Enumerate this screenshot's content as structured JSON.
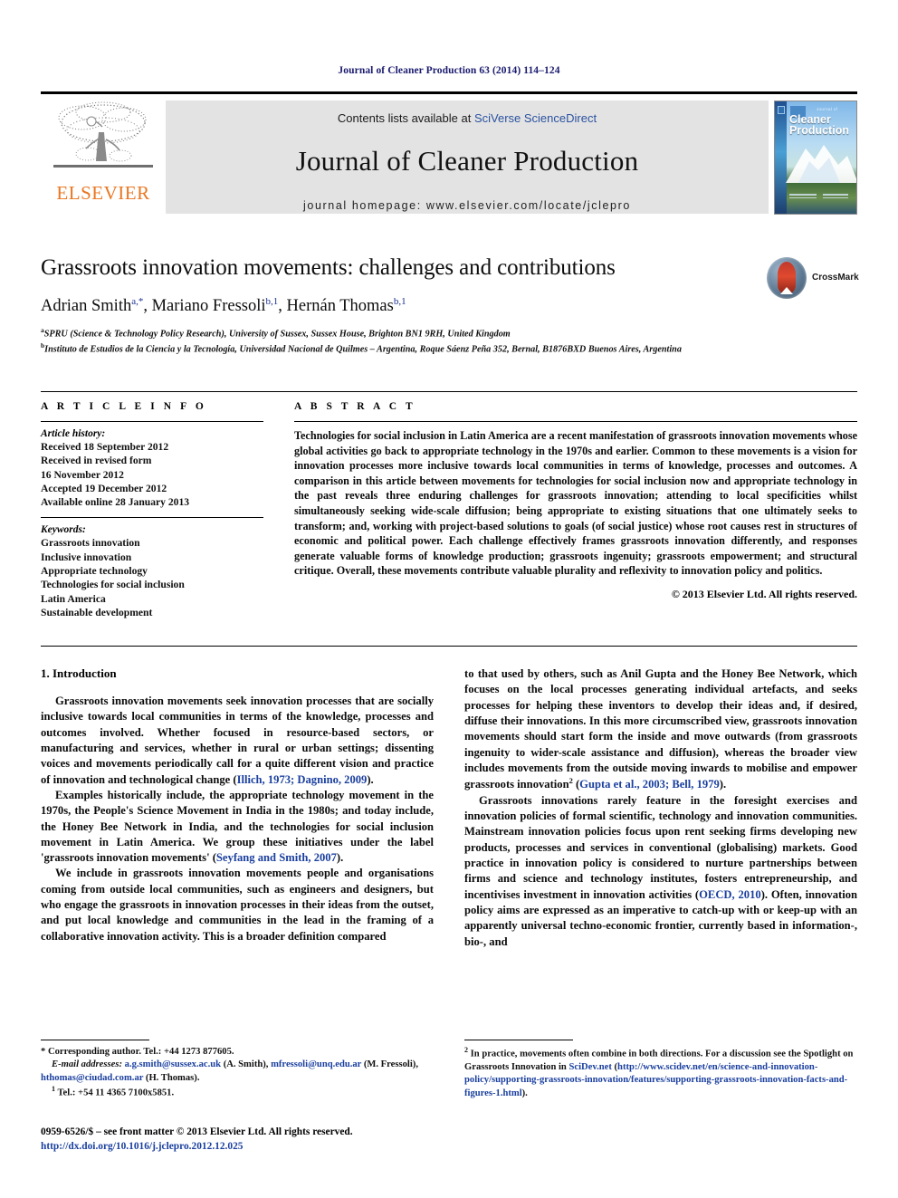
{
  "running_head": "Journal of Cleaner Production 63 (2014) 114–124",
  "masthead": {
    "publisher_name": "ELSEVIER",
    "contents_prefix": "Contents lists available at ",
    "contents_link": "SciVerse ScienceDirect",
    "journal_title": "Journal of Cleaner Production",
    "homepage_line": "journal homepage: www.elsevier.com/locate/jclepro",
    "cover": {
      "kicker": "Journal of",
      "title_line1": "Cleaner",
      "title_line2": "Production"
    }
  },
  "article": {
    "title": "Grassroots innovation movements: challenges and contributions",
    "authors": [
      {
        "name": "Adrian Smith",
        "marks": "a,*"
      },
      {
        "name": "Mariano Fressoli",
        "marks": "b,1"
      },
      {
        "name": "Hernán Thomas",
        "marks": "b,1"
      }
    ],
    "authors_plain": "Adrian Smith a,*, Mariano Fressoli b,1, Hernán Thomas b,1",
    "affiliations": [
      {
        "mark": "a",
        "text": "SPRU (Science & Technology Policy Research), University of Sussex, Sussex House, Brighton BN1 9RH, United Kingdom"
      },
      {
        "mark": "b",
        "text": "Instituto de Estudios de la Ciencia y la Tecnología, Universidad Nacional de Quilmes – Argentina, Roque Sáenz Peña 352, Bernal, B1876BXD Buenos Aires, Argentina"
      }
    ],
    "crossmark_label": "CrossMark"
  },
  "article_info": {
    "section_label": "A R T I C L E   I N F O",
    "history_label": "Article history:",
    "history": [
      "Received 18 September 2012",
      "Received in revised form",
      "16 November 2012",
      "Accepted 19 December 2012",
      "Available online 28 January 2013"
    ],
    "keywords_label": "Keywords:",
    "keywords": [
      "Grassroots innovation",
      "Inclusive innovation",
      "Appropriate technology",
      "Technologies for social inclusion",
      "Latin America",
      "Sustainable development"
    ]
  },
  "abstract": {
    "section_label": "A B S T R A C T",
    "text": "Technologies for social inclusion in Latin America are a recent manifestation of grassroots innovation movements whose global activities go back to appropriate technology in the 1970s and earlier. Common to these movements is a vision for innovation processes more inclusive towards local communities in terms of knowledge, processes and outcomes. A comparison in this article between movements for technologies for social inclusion now and appropriate technology in the past reveals three enduring challenges for grassroots innovation; attending to local specificities whilst simultaneously seeking wide-scale diffusion; being appropriate to existing situations that one ultimately seeks to transform; and, working with project-based solutions to goals (of social justice) whose root causes rest in structures of economic and political power. Each challenge effectively frames grassroots innovation differently, and responses generate valuable forms of knowledge production; grassroots ingenuity; grassroots empowerment; and structural critique. Overall, these movements contribute valuable plurality and reflexivity to innovation policy and politics.",
    "copyright": "© 2013 Elsevier Ltd. All rights reserved."
  },
  "body": {
    "section_number_title": "1. Introduction",
    "left_paragraphs": [
      {
        "pre": "Grassroots innovation movements seek innovation processes that are socially inclusive towards local communities in terms of the knowledge, processes and outcomes involved. Whether focused in resource-based sectors, or manufacturing and services, whether in rural or urban settings; dissenting voices and movements periodically call for a quite different vision and practice of innovation and technological change (",
        "cite": "Illich, 1973; Dagnino, 2009",
        "post": ")."
      },
      {
        "pre": "Examples historically include, the appropriate technology movement in the 1970s, the People's Science Movement in India in the 1980s; and today include, the Honey Bee Network in India, and the technologies for social inclusion movement in Latin America. We group these initiatives under the label 'grassroots innovation movements' (",
        "cite": "Seyfang and Smith, 2007",
        "post": ")."
      },
      {
        "pre": "We include in grassroots innovation movements people and organisations coming from outside local communities, such as engineers and designers, but who engage the grassroots in innovation processes in their ideas from the outset, and put local knowledge and communities in the lead in the framing of a collaborative innovation activity. This is a broader definition compared",
        "cite": "",
        "post": ""
      }
    ],
    "right_paragraphs": [
      {
        "pre": "to that used by others, such as Anil Gupta and the Honey Bee Network, which focuses on the local processes generating individual artefacts, and seeks processes for helping these inventors to develop their ideas and, if desired, diffuse their innovations. In this more circumscribed view, grassroots innovation movements should start form the inside and move outwards (from grassroots ingenuity to wider-scale assistance and diffusion), whereas the broader view includes movements from the outside moving inwards to mobilise and empower grassroots innovation",
        "footnote_marker": "2",
        "mid": " (",
        "cite": "Gupta et al., 2003; Bell, 1979",
        "post": ")."
      },
      {
        "pre": "Grassroots innovations rarely feature in the foresight exercises and innovation policies of formal scientific, technology and innovation communities. Mainstream innovation policies focus upon rent seeking firms developing new products, processes and services in conventional (globalising) markets. Good practice in innovation policy is considered to nurture partnerships between firms and science and technology institutes, fosters entrepreneurship, and incentivises investment in innovation activities (",
        "cite": "OECD, 2010",
        "post": "). Often, innovation policy aims are expressed as an imperative to catch-up with or keep-up with an apparently universal techno-economic frontier, currently based in information-, bio-, and"
      }
    ]
  },
  "footnotes": {
    "left": {
      "corresponding": "* Corresponding author. Tel.: +44 1273 877605.",
      "email_label": "E-mail addresses:",
      "emails": [
        {
          "address": "a.g.smith@sussex.ac.uk",
          "owner": " (A. Smith), "
        },
        {
          "address": "mfressoli@unq.edu.ar",
          "owner": " (M. Fressoli), "
        },
        {
          "address": "hthomas@ciudad.com.ar",
          "owner": " (H. Thomas)."
        }
      ],
      "note1_marker": "1",
      "note1": "Tel.: +54 11 4365 7100x5851."
    },
    "right": {
      "note2_marker": "2",
      "note2_pre": "In practice, movements often combine in both directions. For a discussion see the Spotlight on Grassroots Innovation in ",
      "note2_brand": "SciDev.net",
      "note2_paren_open": " (",
      "note2_url": "http://www.scidev.net/en/science-and-innovation-policy/supporting-grassroots-innovation/features/supporting-grassroots-innovation-facts-and-figures-1.html",
      "note2_paren_close": ")."
    }
  },
  "legal": {
    "issn_line": "0959-6526/$ – see front matter © 2013 Elsevier Ltd. All rights reserved.",
    "doi": "http://dx.doi.org/10.1016/j.jclepro.2012.12.025"
  },
  "colors": {
    "elsevier_orange": "#E87722",
    "link_blue": "#1a3f9e",
    "running_head_navy": "#1a1a6e",
    "masthead_grey": "#e3e3e3"
  }
}
